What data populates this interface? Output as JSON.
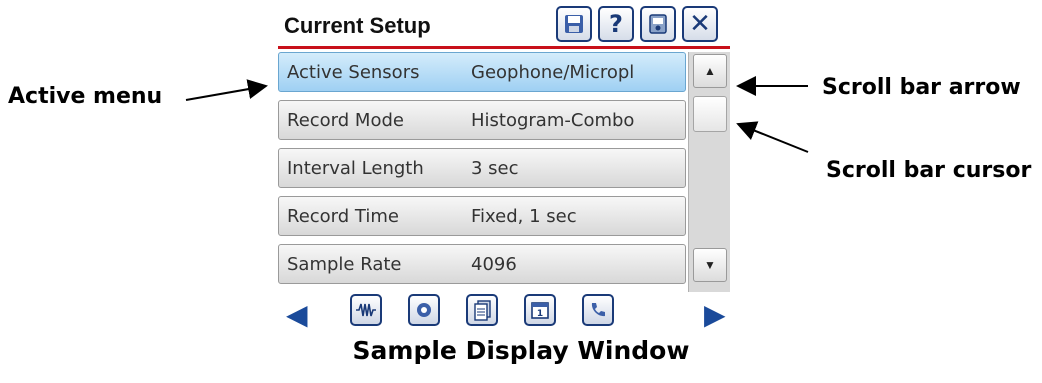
{
  "annotations": {
    "active_menu": "Active menu",
    "scroll_bar_arrow": "Scroll bar arrow",
    "scroll_bar_cursor": "Scroll bar cursor"
  },
  "caption": "Sample Display Window",
  "window": {
    "title": "Current Setup",
    "toolbar_icons": [
      "save-icon",
      "help-icon",
      "device-icon",
      "close-icon"
    ],
    "accent_color": "#c8101a"
  },
  "settings": [
    {
      "key": "Active Sensors",
      "value": "Geophone/Micropl",
      "active": true
    },
    {
      "key": "Record Mode",
      "value": "Histogram-Combo",
      "active": false
    },
    {
      "key": "Interval Length",
      "value": "3 sec",
      "active": false
    },
    {
      "key": "Record Time",
      "value": "Fixed, 1 sec",
      "active": false
    },
    {
      "key": "Sample Rate",
      "value": "4096",
      "active": false
    }
  ],
  "bottom_bar_icons": [
    "waveform-icon",
    "sensor-icon",
    "documents-icon",
    "calendar-icon",
    "phone-icon"
  ]
}
